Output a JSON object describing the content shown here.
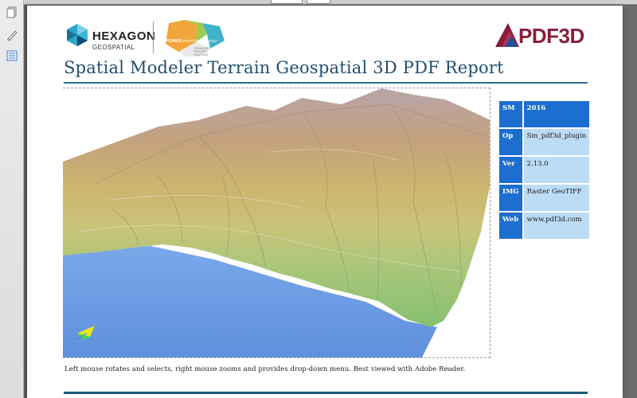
{
  "header": {
    "hexagon_wordmark": "HEXAGON",
    "hexagon_sub": "GEOSPATIAL",
    "power_logo_text": "POWER PORTFOLIO PRODUCER PROVIDER PLATFORM",
    "pdf3d_wordmark": "PDF3D"
  },
  "title": "Spatial Modeler Terrain Geospatial 3D PDF Report",
  "meta": [
    {
      "key": "SM",
      "value": "2016"
    },
    {
      "key": "Op",
      "value": "Sm_pdf3d_plugin"
    },
    {
      "key": "Ver",
      "value": "2.13.0"
    },
    {
      "key": "IMG",
      "value": "Raster GeoTIFF"
    },
    {
      "key": "Web",
      "value": "www.pdf3d.com"
    }
  ],
  "caption": "Left mouse rotates and selects, right mouse zooms and provides drop-down menu. Best viewed with Adobe Reader.",
  "colors": {
    "title": "#1e4f6e",
    "table_key": "#1c6fd1",
    "table_value": "#bcdcf6",
    "water": "#6f9fe6",
    "pdf3d_brand": "#8a1d3a"
  },
  "sidebar": {
    "icons": [
      "pages-icon",
      "signature-icon",
      "layers-icon"
    ]
  }
}
